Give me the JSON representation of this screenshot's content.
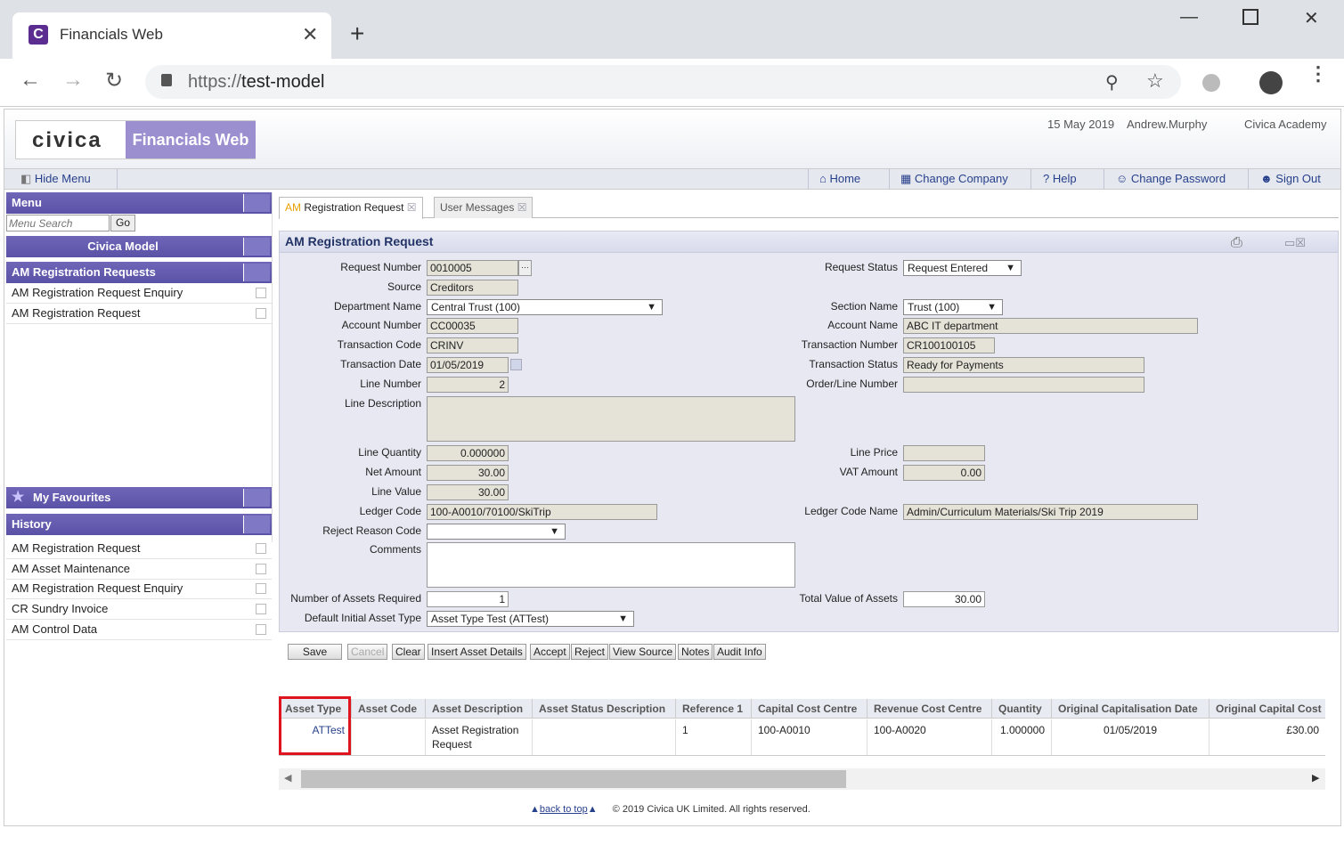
{
  "browser": {
    "tab_title": "Financials Web",
    "tab_icon_letter": "C",
    "url_scheme": "https://",
    "url_host": "test-model"
  },
  "header": {
    "logo_text": "civica",
    "product": "Financials Web",
    "date": "15 May 2019",
    "user": "Andrew.Murphy",
    "org": "Civica Academy"
  },
  "toolbar": {
    "hide_menu": "Hide Menu",
    "home": "Home",
    "change_company": "Change Company",
    "help": "Help",
    "change_password": "Change Password",
    "sign_out": "Sign Out"
  },
  "menu": {
    "title": "Menu",
    "search_placeholder": "Menu Search",
    "go": "Go",
    "company": "Civica Model",
    "section": "AM Registration Requests",
    "items": [
      "AM Registration Request Enquiry",
      "AM Registration Request"
    ],
    "favourites": "My Favourites",
    "history_title": "History",
    "history": [
      "AM Registration Request",
      "AM Asset Maintenance",
      "AM Registration Request Enquiry",
      "CR Sundry Invoice",
      "AM Control Data"
    ]
  },
  "tabs": {
    "tab1_prefix": "AM",
    "tab1_label": "Registration Request",
    "tab2_label": "User Messages"
  },
  "form": {
    "title": "AM Registration Request",
    "request_number_label": "Request Number",
    "request_number": "0010005",
    "source_label": "Source",
    "source": "Creditors",
    "department_label": "Department Name",
    "department": "Central Trust (100)",
    "account_number_label": "Account Number",
    "account_number": "CC00035",
    "transaction_code_label": "Transaction Code",
    "transaction_code": "CRINV",
    "transaction_date_label": "Transaction Date",
    "transaction_date": "01/05/2019",
    "line_number_label": "Line Number",
    "line_number": "2",
    "line_description_label": "Line Description",
    "line_quantity_label": "Line Quantity",
    "line_quantity": "0.000000",
    "net_amount_label": "Net Amount",
    "net_amount": "30.00",
    "line_value_label": "Line Value",
    "line_value": "30.00",
    "ledger_code_label": "Ledger Code",
    "ledger_code": "100-A0010/70100/SkiTrip",
    "reject_reason_label": "Reject Reason Code",
    "comments_label": "Comments",
    "num_assets_label": "Number of Assets Required",
    "num_assets": "1",
    "default_asset_type_label": "Default Initial Asset Type",
    "default_asset_type": "Asset Type Test (ATTest)",
    "request_status_label": "Request Status",
    "request_status": "Request Entered",
    "section_label": "Section Name",
    "section": "Trust (100)",
    "account_name_label": "Account Name",
    "account_name": "ABC IT department",
    "transaction_number_label": "Transaction Number",
    "transaction_number": "CR100100105",
    "transaction_status_label": "Transaction Status",
    "transaction_status": "Ready for Payments",
    "order_line_label": "Order/Line Number",
    "line_price_label": "Line Price",
    "vat_amount_label": "VAT Amount",
    "vat_amount": "0.00",
    "ledger_code_name_label": "Ledger Code Name",
    "ledger_code_name": "Admin/Curriculum Materials/Ski Trip 2019",
    "total_value_label": "Total Value of Assets",
    "total_value": "30.00"
  },
  "buttons": {
    "save": "Save",
    "cancel": "Cancel",
    "clear": "Clear",
    "insert": "Insert Asset Details",
    "accept": "Accept",
    "reject": "Reject",
    "view_source": "View Source",
    "notes": "Notes",
    "audit": "Audit Info"
  },
  "grid": {
    "headers": [
      "Asset Type",
      "Asset Code",
      "Asset Description",
      "Asset Status Description",
      "Reference 1",
      "Capital Cost Centre",
      "Revenue Cost Centre",
      "Quantity",
      "Original Capitalisation Date",
      "Original Capital Cost"
    ],
    "row": [
      "ATTest",
      "",
      "Asset Registration Request",
      "",
      "1",
      "100-A0010",
      "100-A0020",
      "1.000000",
      "01/05/2019",
      "£30.00"
    ]
  },
  "footer": {
    "back_to_top": "back to top",
    "copyright": "© 2019 Civica UK Limited. All rights reserved."
  },
  "colors": {
    "highlight_box": "#e0141e",
    "menu_bar": "#5a52a6",
    "link": "#27408b"
  }
}
